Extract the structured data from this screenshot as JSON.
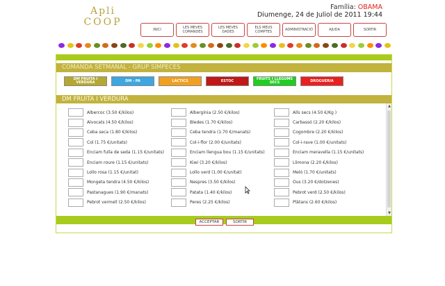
{
  "brand": {
    "line1": "Apli",
    "line2": "COOP"
  },
  "header": {
    "family_label": "Família:",
    "family_name": "OBAMA",
    "date": "Diumenge, 24 de Juliol de 2011 19:44"
  },
  "nav": [
    {
      "label": "INICI",
      "name": "nav-inici"
    },
    {
      "label": "LES MEVES COMANDES",
      "name": "nav-comandes"
    },
    {
      "label": "LES MEVES DADES",
      "name": "nav-dades"
    },
    {
      "label": "ELS MEUS COMPTES",
      "name": "nav-comptes"
    },
    {
      "label": "ADMINISTRACIÓ",
      "name": "nav-administracio"
    },
    {
      "label": "AJUDA",
      "name": "nav-ajuda"
    },
    {
      "label": "SORTIR",
      "name": "nav-sortir"
    }
  ],
  "order_title": "COMANDA SETMANAL - GRUP SIMPECES",
  "categories": [
    {
      "label": "DM FRUITA I VERDURA",
      "color": "#b4a832"
    },
    {
      "label": "DM - PA",
      "color": "#3ea6e0"
    },
    {
      "label": "LACTICS",
      "color": "#f0a020"
    },
    {
      "label": "ESTOC",
      "color": "#c01818"
    },
    {
      "label": "FRUITS I LLEGUMS SECS",
      "color": "#22cc22"
    },
    {
      "label": "DROGUERIA",
      "color": "#e82020"
    }
  ],
  "section_title": "DM FRUITA I VERDURA",
  "products": {
    "col1": [
      "Albercoc (3.50 €/kilos)",
      "Alvocats (4.50 €/kilos)",
      "Ceba seca (1.80 €/kilos)",
      "Col (1.75 €/unitats)",
      "Enciam fulla de seda (1.15 €/unitats)",
      "Enciam roure (1.15 €/unitats)",
      "Lollo rosa (1.15 €/unitat)",
      "Mongeta tendra (4.50 €/kilos)",
      "Pastanagues (1.90 €/manats)",
      "Pebrot vermell (2.50 €/kilos)"
    ],
    "col2": [
      "Albergínia (2.50 €/kilos)",
      "Bledes (1.70 €/kilos)",
      "Ceba tendra (1.70 €/manats)",
      "Col-i-flor (2.00 €/unitats)",
      "Enciam llengua bou (1.15 €/unitats)",
      "Kiwi (3.20 €/kilos)",
      "Lollo verd (1.00 €/unitat)",
      "Nespres (3.50 €/kilos)",
      "Patata (1.40 €/kilos)",
      "Peres (2.25 €/kilos)"
    ],
    "col3": [
      "Alls secs (4.50 €/Kg )",
      "Carbassó (2.20 €/kilos)",
      "Cogombre (2.20 €/kilos)",
      "Col-i-rave (1.00 €/unitats)",
      "Enciam meravella (1.15 €/unitats)",
      "Llimona (2.20 €/kilos)",
      "Meló (1.70 €/unitats)",
      "Ous (3.20 €/dotzenes)",
      "Pebrot verd (2.50 €/kilos)",
      "Plàtans (2.60 €/kilos)"
    ]
  },
  "actions": {
    "accept": "ACCEPTAR",
    "exit": "SORTIR"
  },
  "fruit_colors": [
    "#8a2be2",
    "#e4c21a",
    "#e23a2a",
    "#e48a1a",
    "#6b8e23",
    "#d2691e",
    "#8b4513",
    "#4a6b2a",
    "#c9302c",
    "#f2d64b",
    "#9acd32",
    "#ff8c00"
  ],
  "icons": {
    "scroll_up": "▲",
    "scroll_down": "▼"
  }
}
